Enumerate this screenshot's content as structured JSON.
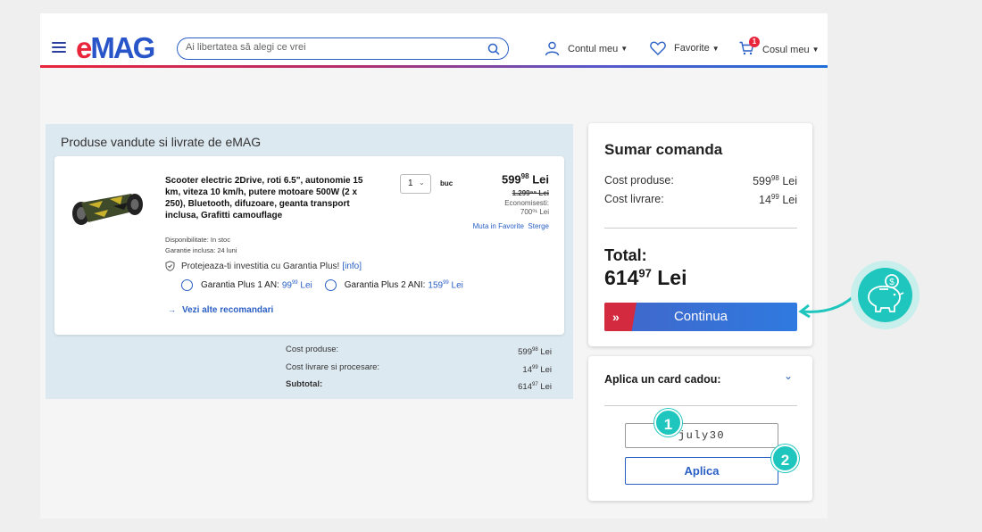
{
  "header": {
    "logo_e": "e",
    "logo_mag": "MAG",
    "search_placeholder": "Ai libertatea să alegi ce vrei",
    "account_label": "Contul meu",
    "favorites_label": "Favorite",
    "cart_label": "Cosul meu",
    "cart_count": "1"
  },
  "cart": {
    "section_title": "Produse vandute si livrate de eMAG",
    "product": {
      "name": "Scooter electric 2Drive, roti 6.5\", autonomie 15 km, viteza 10 km/h, putere motoare 500W (2 x 250), Bluetooth, difuzoare, geanta transport inclusa, Grafitti camouflage",
      "quantity": "1",
      "unit": "buc",
      "price_int": "599",
      "price_dec": "98",
      "currency": "Lei",
      "old_price": "1.299⁹⁹ Lei",
      "savings_label": "Economisesti:",
      "savings_value": "700⁰¹ Lei",
      "move_to_fav": "Muta in Favorite",
      "delete": "Sterge",
      "availability": "Disponibilitate: In stoc",
      "warranty": "Garantie inclusa:  24 luni",
      "protect_text": "Protejeaza-ti investitia cu Garantia Plus!",
      "protect_info": "[info]",
      "option1_label": "Garantia Plus 1 AN:",
      "option1_price_int": "99",
      "option1_price_dec": "99",
      "option2_label": "Garantia Plus 2 ANI:",
      "option2_price_int": "159",
      "option2_price_dec": "99",
      "option_currency": "Lei",
      "more_recs": "Vezi alte recomandari"
    },
    "summary": {
      "products_label": "Cost produse:",
      "products_int": "599",
      "products_dec": "98",
      "shipping_label": "Cost livrare si procesare:",
      "shipping_int": "14",
      "shipping_dec": "99",
      "subtotal_label": "Subtotal:",
      "subtotal_int": "614",
      "subtotal_dec": "97",
      "currency": "Lei"
    }
  },
  "order_summary": {
    "title": "Sumar comanda",
    "products_label": "Cost produse:",
    "products_int": "599",
    "products_dec": "98",
    "shipping_label": "Cost livrare:",
    "shipping_int": "14",
    "shipping_dec": "99",
    "currency": "Lei",
    "total_label": "Total:",
    "total_int": "614",
    "total_dec": "97",
    "total_currency": "Lei",
    "continue_label": "Continua"
  },
  "gift_card": {
    "title": "Aplica un card cadou:",
    "code_value": "july30",
    "apply_label": "Aplica"
  },
  "steps": {
    "step1": "1",
    "step2": "2"
  },
  "colors": {
    "brand_red": "#e8253b",
    "brand_blue": "#2855c8",
    "accent_teal": "#1fc6bd"
  }
}
